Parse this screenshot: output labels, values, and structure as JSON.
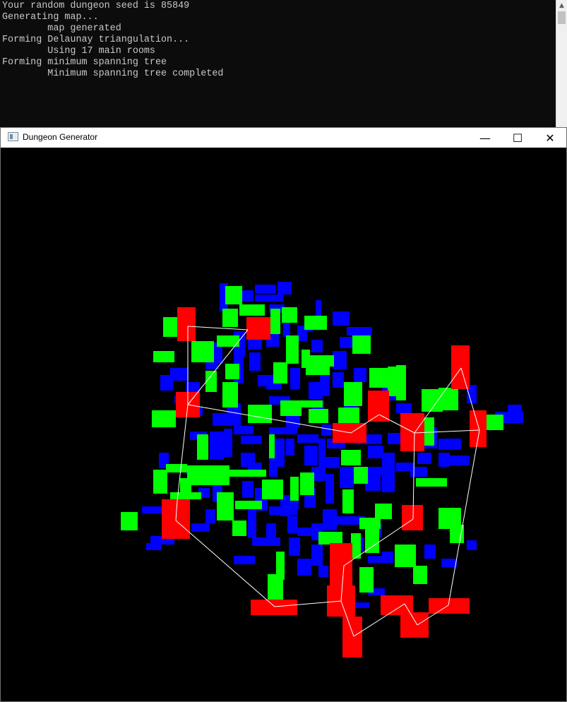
{
  "console": {
    "lines": [
      "Your random dungeon seed is 85849",
      "Generating map...",
      "        map generated",
      "Forming Delaunay triangulation...",
      "        Using 17 main rooms",
      "Forming minimum spanning tree",
      "        Minimum spanning tree completed"
    ]
  },
  "window": {
    "title": "Dungeon Generator",
    "controls": {
      "minimize": "—",
      "maximize": "☐",
      "close": "✕"
    }
  },
  "colors": {
    "main_room": "#ff0000",
    "secondary_room": "#00ff00",
    "hallway_room": "#0000ff",
    "mst_edge": "#ffffff",
    "background": "#000000"
  }
}
